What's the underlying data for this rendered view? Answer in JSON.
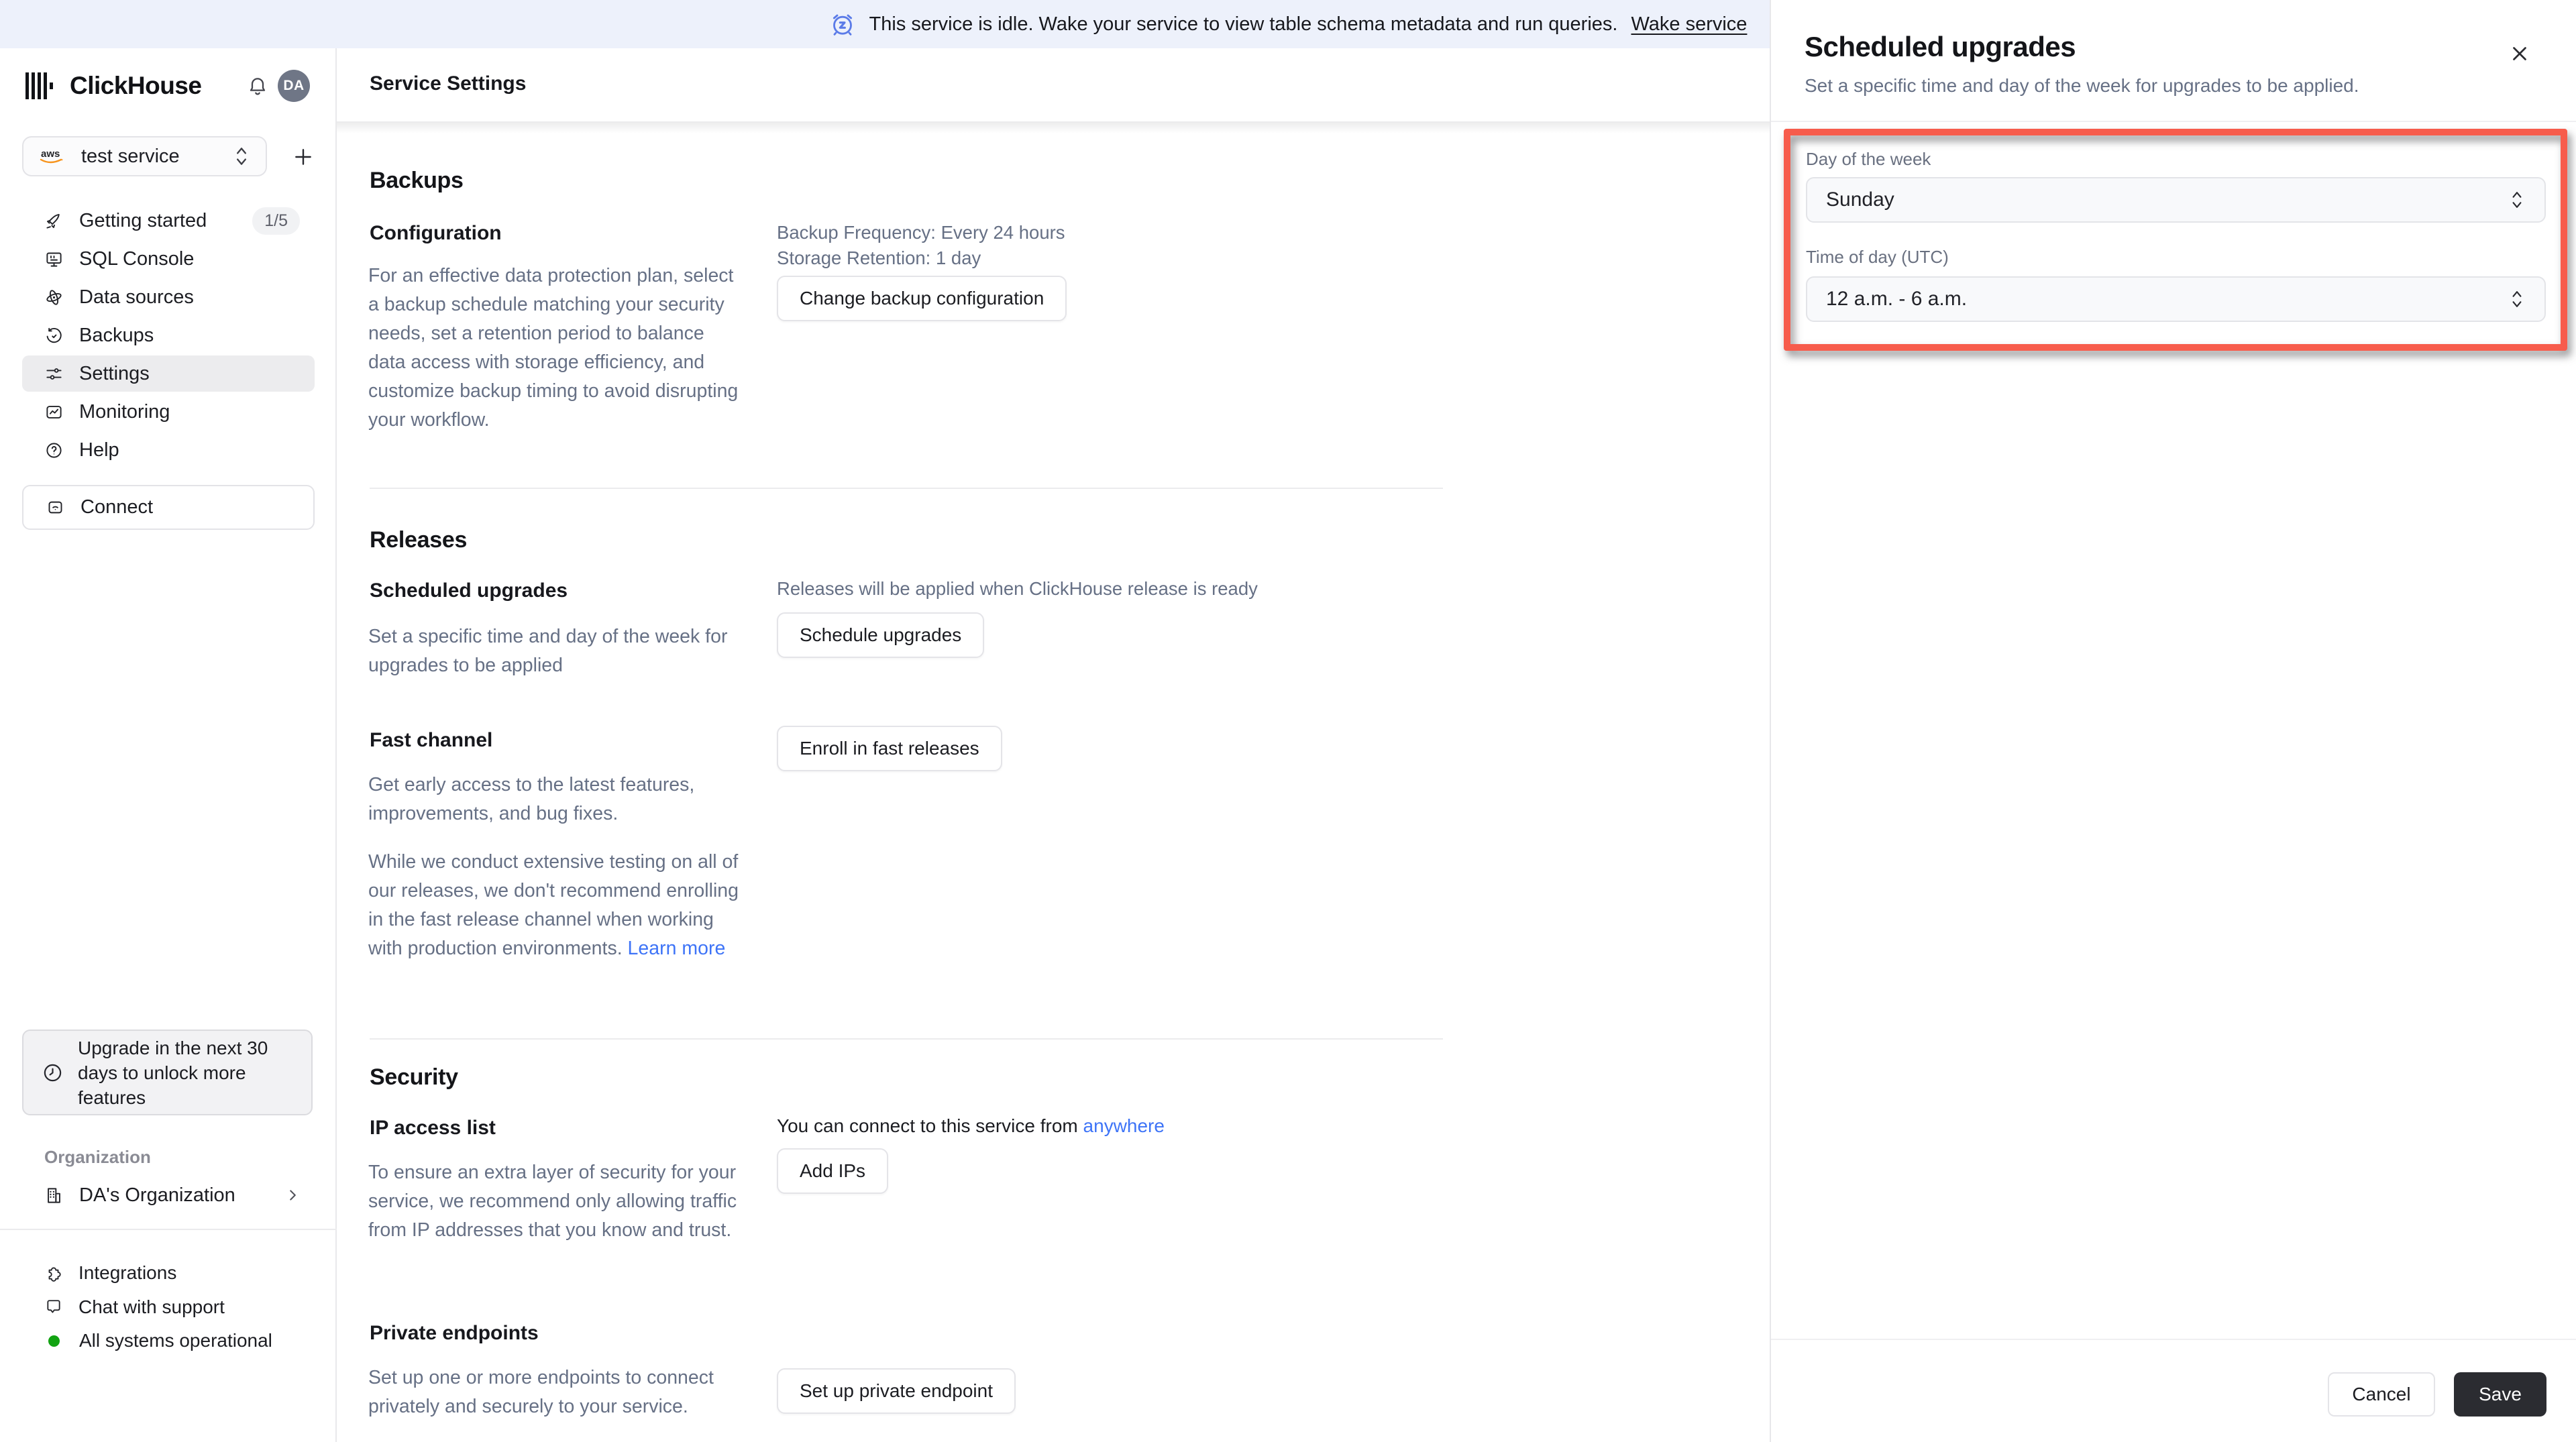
{
  "banner": {
    "message": "This service is idle. Wake your service to view table schema metadata and run queries.",
    "action": "Wake service"
  },
  "header": {
    "brand": "ClickHouse",
    "avatar_initials": "DA",
    "service_selector": {
      "value": "test service",
      "provider": "aws"
    }
  },
  "sidebar": {
    "items": [
      {
        "label": "Getting started",
        "icon": "rocket-icon",
        "badge": "1/5"
      },
      {
        "label": "SQL Console",
        "icon": "sql-console-icon"
      },
      {
        "label": "Data sources",
        "icon": "data-sources-icon"
      },
      {
        "label": "Backups",
        "icon": "backups-history-icon"
      },
      {
        "label": "Settings",
        "icon": "settings-sliders-icon",
        "active": true
      },
      {
        "label": "Monitoring",
        "icon": "monitoring-chart-icon"
      },
      {
        "label": "Help",
        "icon": "help-circle-icon"
      }
    ],
    "connect_label": "Connect",
    "upgrade_banner": "Upgrade in the next 30 days to unlock more features",
    "organization_section_label": "Organization",
    "organization_name": "DA's Organization",
    "footer_items": [
      {
        "label": "Integrations",
        "icon": "puzzle-icon"
      },
      {
        "label": "Chat with support",
        "icon": "chat-bubble-icon"
      },
      {
        "label": "All systems operational",
        "icon": "status-dot",
        "status_color": "#12A312"
      }
    ]
  },
  "main": {
    "title": "Service Settings",
    "backups": {
      "heading": "Backups",
      "subheading": "Configuration",
      "meta_lines": [
        "Backup Frequency: Every 24 hours",
        "Storage Retention: 1 day"
      ],
      "button": "Change backup configuration",
      "description": "For an effective data protection plan, select a backup schedule matching your security needs, set a retention period to balance data access with storage efficiency, and customize backup timing to avoid disrupting your workflow."
    },
    "releases": {
      "heading": "Releases",
      "scheduled_upgrades": {
        "subheading": "Scheduled upgrades",
        "meta": "Releases will be applied when ClickHouse release is ready",
        "button": "Schedule upgrades",
        "description": "Set a specific time and day of the week for upgrades to be applied"
      },
      "fast_channel": {
        "subheading": "Fast channel",
        "button": "Enroll in fast releases",
        "description_1": "Get early access to the latest features, improvements, and bug fixes.",
        "description_2": "While we conduct extensive testing on all of our releases, we don't recommend enrolling in the fast release channel when working with production environments.",
        "link": "Learn more"
      }
    },
    "security": {
      "heading": "Security",
      "ip_access_list": {
        "subheading": "IP access list",
        "meta_prefix": "You can connect to this service from",
        "meta_link": "anywhere",
        "button": "Add IPs",
        "description": "To ensure an extra layer of security for your service, we recommend only allowing traffic from IP addresses that you know and trust."
      },
      "private_endpoints": {
        "subheading": "Private endpoints",
        "button": "Set up private endpoint",
        "description": "Set up one or more endpoints to connect privately and securely to your service."
      }
    }
  },
  "panel": {
    "title": "Scheduled upgrades",
    "subtitle": "Set a specific time and day of the week for upgrades to be applied.",
    "fields": [
      {
        "label": "Day of the week",
        "value": "Sunday"
      },
      {
        "label": "Time of day (UTC)",
        "value": "12 a.m. - 6 a.m."
      }
    ],
    "cancel_label": "Cancel",
    "save_label": "Save"
  },
  "colors": {
    "annotation_red": "#F75C4C",
    "link_blue": "#3E74F7",
    "banner_bg": "#EDF1FB",
    "banner_icon_blue": "#5B7BE8",
    "status_green": "#12A312",
    "save_button_bg": "#2B2C31"
  }
}
